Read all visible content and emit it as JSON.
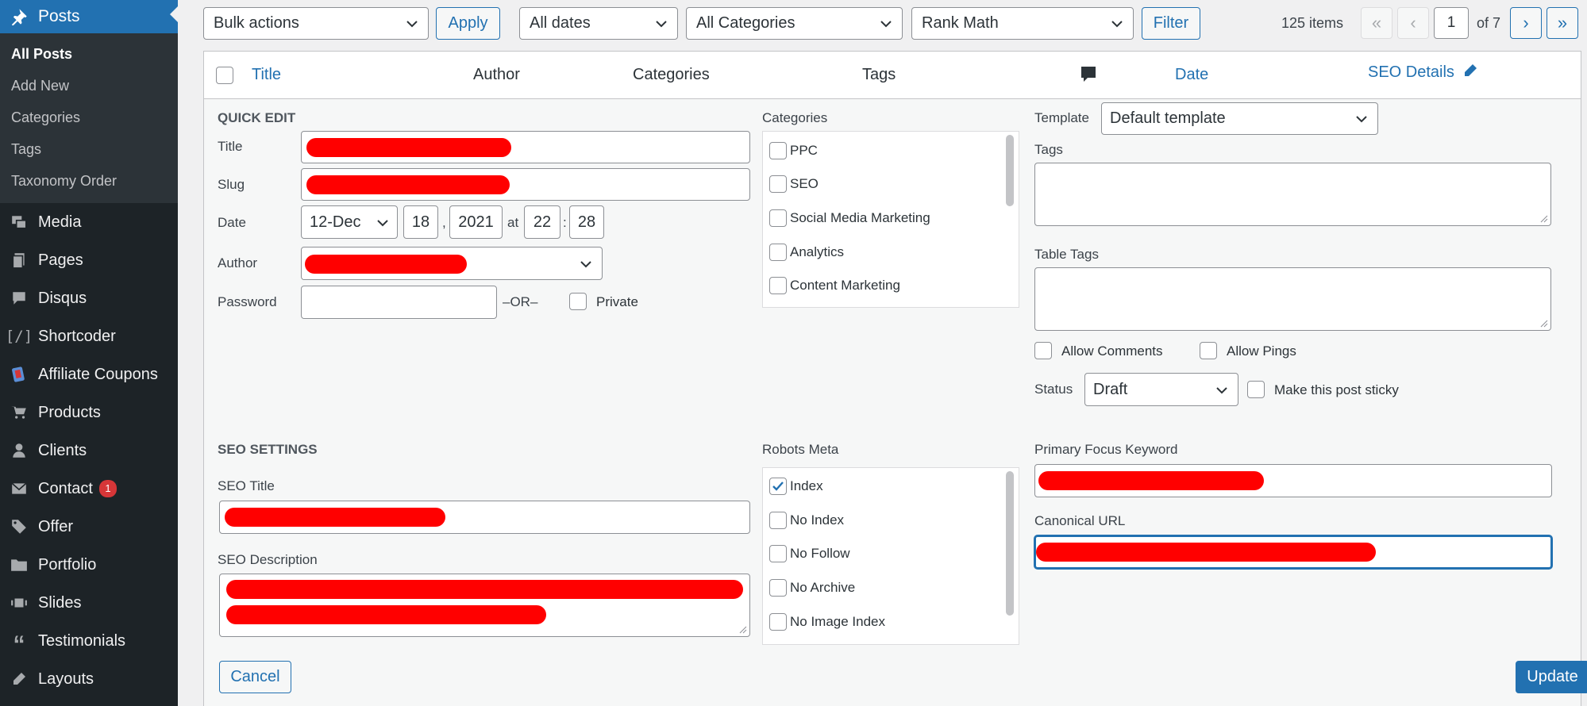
{
  "sidebar": {
    "current": "Posts",
    "submenu": [
      "All Posts",
      "Add New",
      "Categories",
      "Tags",
      "Taxonomy Order"
    ],
    "items": [
      {
        "label": "Media",
        "icon": "media-icon"
      },
      {
        "label": "Pages",
        "icon": "pages-icon"
      },
      {
        "label": "Disqus",
        "icon": "comment-icon"
      },
      {
        "label": "Shortcoder",
        "icon": "shortcode-icon"
      },
      {
        "label": "Affiliate Coupons",
        "icon": "coupon-icon"
      },
      {
        "label": "Products",
        "icon": "cart-icon"
      },
      {
        "label": "Clients",
        "icon": "user-icon"
      },
      {
        "label": "Contact",
        "icon": "mail-icon",
        "badge": "1"
      },
      {
        "label": "Offer",
        "icon": "tag-icon"
      },
      {
        "label": "Portfolio",
        "icon": "folder-icon"
      },
      {
        "label": "Slides",
        "icon": "slides-icon"
      },
      {
        "label": "Testimonials",
        "icon": "quote-icon"
      },
      {
        "label": "Layouts",
        "icon": "pencil-icon"
      }
    ]
  },
  "toolbar": {
    "bulk_actions": "Bulk actions",
    "apply": "Apply",
    "dates": "All dates",
    "categories": "All Categories",
    "seo": "Rank Math",
    "filter": "Filter",
    "items_count": "125 items",
    "page": "1",
    "of_pages": "of 7",
    "first": "«",
    "prev": "‹",
    "next": "›",
    "last": "»"
  },
  "columns": {
    "title": "Title",
    "author": "Author",
    "categories": "Categories",
    "tags": "Tags",
    "date": "Date",
    "seo_details": "SEO Details"
  },
  "quick_edit": {
    "heading": "QUICK EDIT",
    "title_label": "Title",
    "slug_label": "Slug",
    "date_label": "Date",
    "month": "12-Dec",
    "day": "18",
    "comma": ",",
    "year": "2021",
    "at": "at",
    "hour": "22",
    "colon": ":",
    "minute": "28",
    "author_label": "Author",
    "password_label": "Password",
    "or": "–OR–",
    "private": "Private",
    "categories_label": "Categories",
    "category_list": [
      "PPC",
      "SEO",
      "Social Media Marketing",
      "Analytics",
      "Content Marketing"
    ],
    "template_label": "Template",
    "template_value": "Default template",
    "tags_label": "Tags",
    "table_tags_label": "Table Tags",
    "allow_comments": "Allow Comments",
    "allow_pings": "Allow Pings",
    "status_label": "Status",
    "status_value": "Draft",
    "sticky": "Make this post sticky"
  },
  "seo_settings": {
    "heading": "SEO SETTINGS",
    "seo_title_label": "SEO Title",
    "seo_description_label": "SEO Description",
    "robots_label": "Robots Meta",
    "robots": [
      {
        "label": "Index",
        "checked": true
      },
      {
        "label": "No Index",
        "checked": false
      },
      {
        "label": "No Follow",
        "checked": false
      },
      {
        "label": "No Archive",
        "checked": false
      },
      {
        "label": "No Image Index",
        "checked": false
      }
    ],
    "focus_keyword_label": "Primary Focus Keyword",
    "canonical_label": "Canonical URL"
  },
  "actions": {
    "cancel": "Cancel",
    "update": "Update"
  },
  "colors": {
    "accent": "#2271b1",
    "sidebar": "#1d2327",
    "redaction": "#ff0000",
    "badge": "#d63638"
  }
}
